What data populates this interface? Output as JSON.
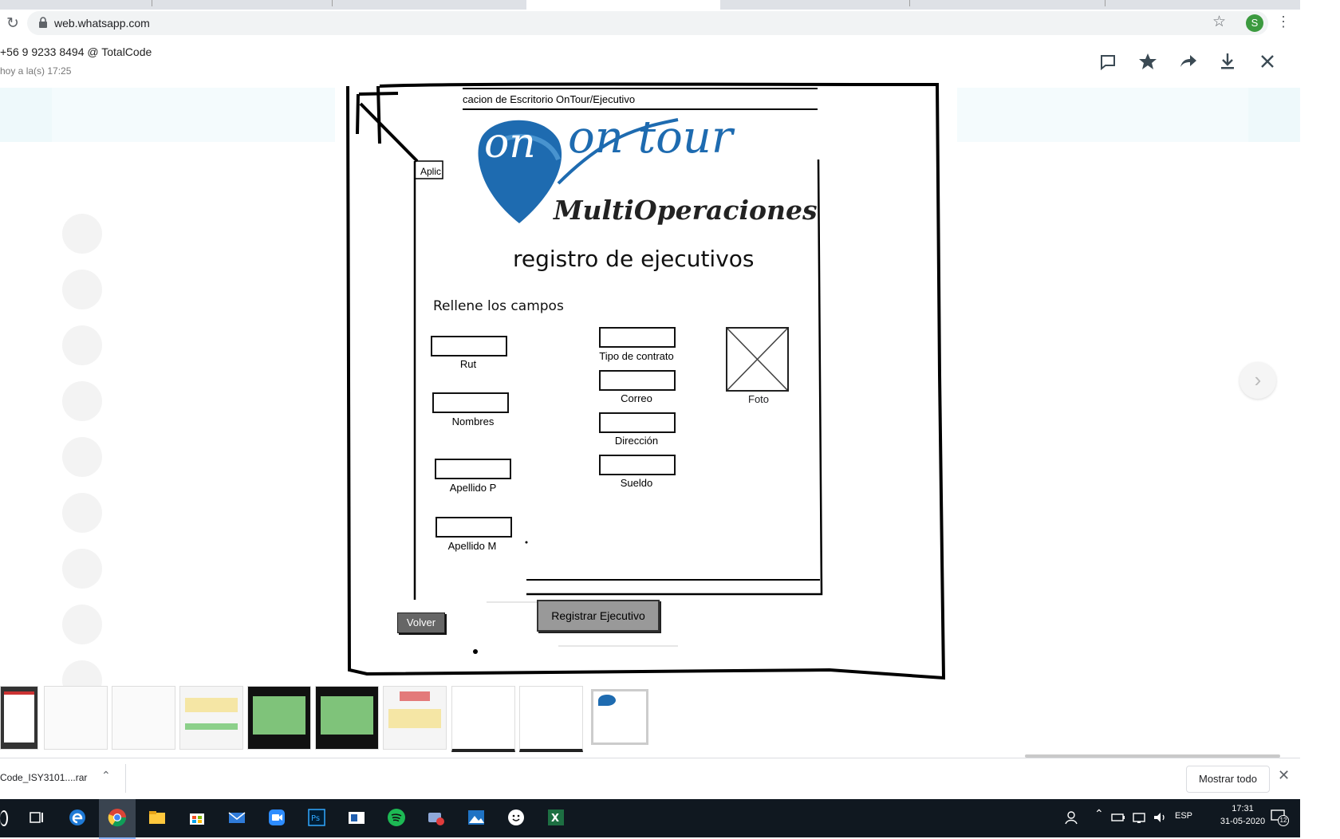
{
  "browser": {
    "url": "web.whatsapp.com",
    "profile_initial": "S"
  },
  "viewer": {
    "title": "+56 9 9233 8494 @ TotalCode",
    "subtitle": "hoy a la(s) 17:25",
    "icons": [
      "message-icon",
      "star-icon",
      "forward-icon",
      "download-icon",
      "close-icon"
    ]
  },
  "sketch": {
    "window_title": "cacion de Escritorio OnTour/Ejecutivo",
    "aplic_fragment": "Aplic",
    "logo_brand": "on tour",
    "logo_sub": "MultiOperaciones",
    "heading": "registro de ejecutivos",
    "instructions": "Rellene los campos",
    "fields": {
      "rut": "Rut",
      "nombres": "Nombres",
      "apellido_p": "Apellido P",
      "apellido_m": "Apellido M",
      "tipo_contrato": "Tipo de contrato",
      "correo": "Correo",
      "direccion": "Dirección",
      "sueldo": "Sueldo"
    },
    "photo_label": "Foto",
    "register_button": "Registrar Ejecutivo",
    "back_button": "Volver"
  },
  "downloads": {
    "file_name": "Code_ISY3101....rar",
    "show_all": "Mostrar todo"
  },
  "taskbar": {
    "language": "ESP",
    "time": "17:31",
    "date": "31-05-2020",
    "notification_count": "12"
  },
  "colors": {
    "logo_blue": "#1e6bb0",
    "taskbar": "#101820",
    "profile": "#3c9a3f"
  }
}
